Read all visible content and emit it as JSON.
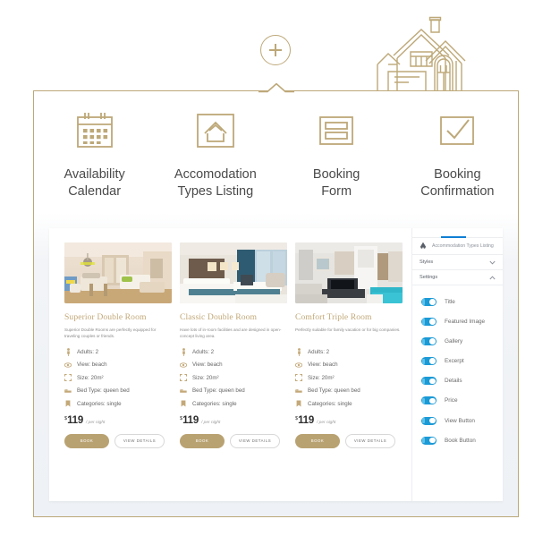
{
  "header": {
    "add_button_icon": "plus-icon",
    "house_icon": "house-illustration"
  },
  "features": [
    {
      "icon": "calendar-icon",
      "label_line1": "Availability",
      "label_line2": "Calendar"
    },
    {
      "icon": "house-box-icon",
      "label_line1": "Accomodation",
      "label_line2": "Types Listing"
    },
    {
      "icon": "form-icon",
      "label_line1": "Booking",
      "label_line2": "Form"
    },
    {
      "icon": "checkmark-icon",
      "label_line1": "Booking",
      "label_line2": "Confirmation"
    }
  ],
  "preview": {
    "rooms": [
      {
        "image": "superior-double-room-photo",
        "title": "Superior Double Room",
        "description": "Superior Double Rooms are perfectly equipped for traveling couples or friends.",
        "features": [
          {
            "icon": "person-icon",
            "text": "Adults: 2"
          },
          {
            "icon": "eye-icon",
            "text": "View: beach"
          },
          {
            "icon": "resize-icon",
            "text": "Size: 20m²"
          },
          {
            "icon": "bed-icon",
            "text": "Bed Type: queen bed"
          },
          {
            "icon": "bookmark-icon",
            "text": "Categories: single"
          }
        ],
        "price_currency": "$",
        "price_value": "119",
        "price_period": "/ per night",
        "book_label": "BOOK",
        "view_label": "VIEW DETAILS"
      },
      {
        "image": "classic-double-room-photo",
        "title": "Classic Double Room",
        "description": "Have lots of in-room facilities and are designed in open-concept living area.",
        "features": [
          {
            "icon": "person-icon",
            "text": "Adults: 2"
          },
          {
            "icon": "eye-icon",
            "text": "View: beach"
          },
          {
            "icon": "resize-icon",
            "text": "Size: 20m²"
          },
          {
            "icon": "bed-icon",
            "text": "Bed Type: queen bed"
          },
          {
            "icon": "bookmark-icon",
            "text": "Categories: single"
          }
        ],
        "price_currency": "$",
        "price_value": "119",
        "price_period": "/ per night",
        "book_label": "BOOK",
        "view_label": "VIEW DETAILS"
      },
      {
        "image": "comfort-triple-room-photo",
        "title": "Comfort Triple Room",
        "description": "Perfectly suitable for family vacation or for big companies.",
        "features": [
          {
            "icon": "person-icon",
            "text": "Adults: 2"
          },
          {
            "icon": "eye-icon",
            "text": "View: beach"
          },
          {
            "icon": "resize-icon",
            "text": "Size: 20m²"
          },
          {
            "icon": "bed-icon",
            "text": "Bed Type: queen bed"
          },
          {
            "icon": "bookmark-icon",
            "text": "Categories: single"
          }
        ],
        "price_currency": "$",
        "price_value": "119",
        "price_period": "/ per night",
        "book_label": "BOOK",
        "view_label": "VIEW DETAILS"
      }
    ],
    "sidebar": {
      "widget_icon": "widget-icon",
      "widget_name": "Accommodation Types Listing",
      "sections": [
        {
          "label": "Styles",
          "state": "collapsed",
          "chevron": "chevron-down-icon"
        },
        {
          "label": "Settings",
          "state": "expanded",
          "chevron": "chevron-up-icon"
        }
      ],
      "toggles": [
        {
          "label": "Title",
          "on": true
        },
        {
          "label": "Featured Image",
          "on": true
        },
        {
          "label": "Gallery",
          "on": true
        },
        {
          "label": "Excerpt",
          "on": true
        },
        {
          "label": "Details",
          "on": true
        },
        {
          "label": "Price",
          "on": true
        },
        {
          "label": "View Button",
          "on": true
        },
        {
          "label": "Book Button",
          "on": true
        }
      ]
    }
  },
  "colors": {
    "gold": "#bda878",
    "gold_title": "#c2a878",
    "book_button": "#b9a272",
    "toggle_on": "#1b9ad6",
    "tab_accent": "#0f7fd4",
    "text_dark": "#4a4a4a"
  }
}
